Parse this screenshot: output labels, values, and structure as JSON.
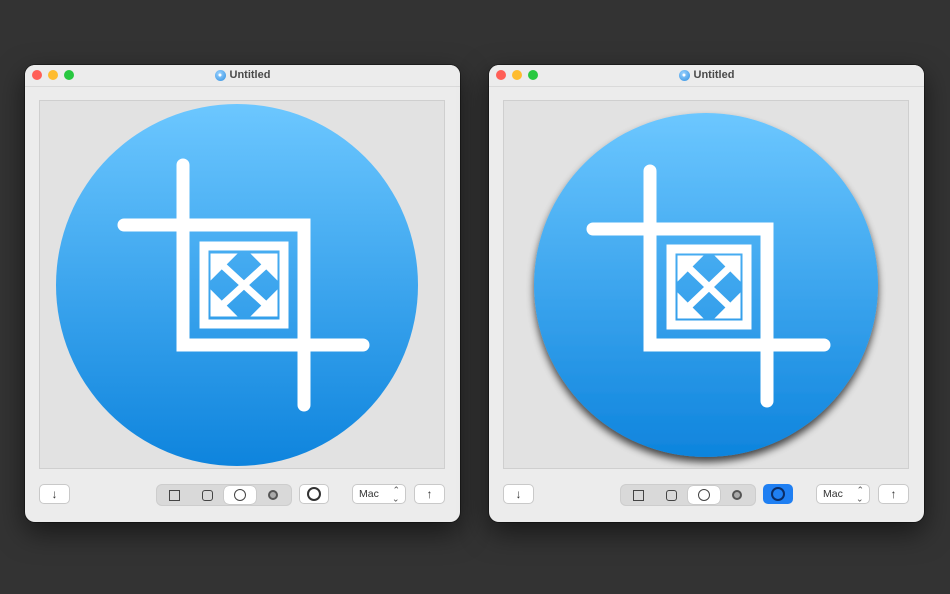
{
  "windows": [
    {
      "title": "Untitled",
      "shadow_enabled": false,
      "selected_shape": "circle",
      "format_value": "Mac",
      "import_icon": "↓",
      "export_icon": "↑"
    },
    {
      "title": "Untitled",
      "shadow_enabled": true,
      "selected_shape": "circle",
      "format_value": "Mac",
      "import_icon": "↓",
      "export_icon": "↑"
    }
  ],
  "shapes": [
    "square",
    "rounded-square",
    "circle",
    "ring"
  ],
  "colors": {
    "close": "#ff5f57",
    "minimize": "#febc2e",
    "zoom": "#28c840",
    "icon_top": "#6cc7ff",
    "icon_bottom": "#0e84dd",
    "accent": "#1f7ff2"
  },
  "icons": {
    "app_icon": "crop-with-expand-arrows-icon",
    "doc_icon": "document-proxy-icon"
  }
}
